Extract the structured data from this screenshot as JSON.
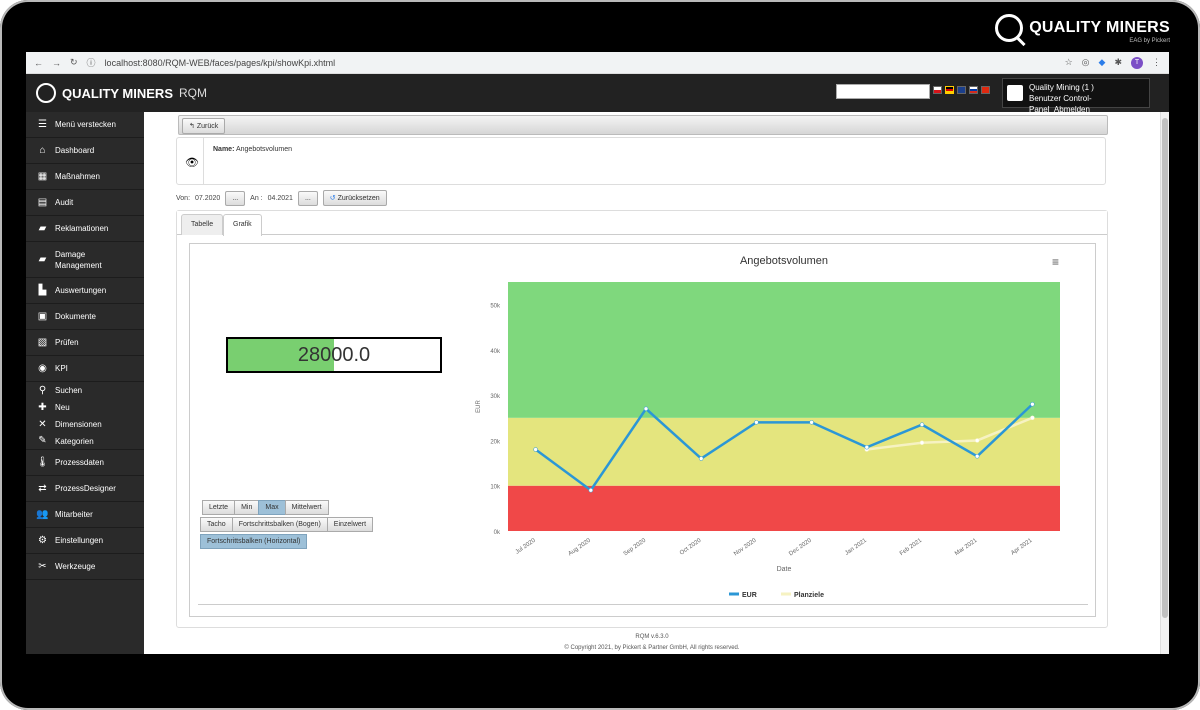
{
  "brand": {
    "name": "QUALITY MINERS",
    "sub": "EAG by Pickert"
  },
  "browser": {
    "url": "localhost:8080/RQM-WEB/faces/pages/kpi/showKpi.xhtml",
    "avatar": "T"
  },
  "app": {
    "title": "QUALITY MINERS",
    "product": "RQM"
  },
  "user": {
    "line1": "Quality Mining (1 )",
    "line2": "Benutzer Control-Panel",
    "logout": "Abmelden"
  },
  "sidebar": {
    "items": [
      {
        "label": "Menü verstecken",
        "icon": "menu-icon"
      },
      {
        "label": "Dashboard",
        "icon": "home-icon"
      },
      {
        "label": "Maßnahmen",
        "icon": "table-icon"
      },
      {
        "label": "Audit",
        "icon": "clipboard-icon"
      },
      {
        "label": "Reklamationen",
        "icon": "document-icon"
      },
      {
        "label": "Damage Management",
        "icon": "damage-icon"
      },
      {
        "label": "Auswertungen",
        "icon": "bar-chart-icon"
      },
      {
        "label": "Dokumente",
        "icon": "file-icon"
      },
      {
        "label": "Prüfen",
        "icon": "check-icon"
      },
      {
        "label": "KPI",
        "icon": "gauge-icon"
      },
      {
        "label": "Suchen",
        "icon": "search-icon"
      },
      {
        "label": "Neu",
        "icon": "plus-icon"
      },
      {
        "label": "Dimensionen",
        "icon": "dimension-icon"
      },
      {
        "label": "Kategorien",
        "icon": "category-icon"
      },
      {
        "label": "Prozessdaten",
        "icon": "thermometer-icon"
      },
      {
        "label": "ProzessDesigner",
        "icon": "shuffle-icon"
      },
      {
        "label": "Mitarbeiter",
        "icon": "users-icon"
      },
      {
        "label": "Einstellungen",
        "icon": "gear-icon"
      },
      {
        "label": "Werkzeuge",
        "icon": "tools-icon"
      }
    ]
  },
  "toolbar": {
    "back": "Zurück"
  },
  "kpi": {
    "name_label": "Name:",
    "name_value": "Angebotsvolumen"
  },
  "dates": {
    "from_label": "Von:",
    "from_value": "07.2020",
    "to_label": "An :",
    "to_value": "04.2021",
    "picker": "...",
    "reset": "Zurücksetzen"
  },
  "tabs": {
    "table": "Tabelle",
    "graphic": "Grafik"
  },
  "gauge": {
    "value": "28000.0",
    "fill_fraction": 0.5
  },
  "buttons": {
    "row1": [
      "Letzte",
      "Min",
      "Max",
      "Mittelwert"
    ],
    "row2": [
      "Tacho",
      "Fortschrittsbalken (Bogen)",
      "Einzelwert"
    ],
    "row3": [
      "Fortschrittsbalken (Horizontal)"
    ],
    "selected": [
      "Max",
      "Fortschrittsbalken (Horizontal)"
    ]
  },
  "chart_data": {
    "type": "line",
    "title": "Angebotsvolumen",
    "xlabel": "Date",
    "ylabel": "EUR",
    "categories": [
      "Jul 2020",
      "Aug 2020",
      "Sep 2020",
      "Oct 2020",
      "Nov 2020",
      "Dec 2020",
      "Jan 2021",
      "Feb 2021",
      "Mar 2021",
      "Apr 2021"
    ],
    "y_ticks": [
      "0k",
      "10k",
      "20k",
      "30k",
      "40k",
      "50k"
    ],
    "ylim": [
      0,
      55000
    ],
    "bands": [
      {
        "from": 0,
        "to": 10000,
        "color": "#f04848"
      },
      {
        "from": 10000,
        "to": 25000,
        "color": "#e4e57e"
      },
      {
        "from": 25000,
        "to": 55000,
        "color": "#7fd87d"
      }
    ],
    "series": [
      {
        "name": "EUR",
        "color": "#2b97d6",
        "values": [
          18000,
          9000,
          27000,
          16000,
          24000,
          24000,
          18500,
          23500,
          16500,
          28000
        ]
      },
      {
        "name": "Planziele",
        "color": "#f6f2c2",
        "values": [
          null,
          null,
          null,
          null,
          null,
          null,
          18000,
          19500,
          20000,
          25000
        ]
      }
    ],
    "legend_position": "bottom"
  },
  "footer": {
    "version": "RQM v.6.3.0",
    "copyright": "© Copyright 2021, by Pickert & Partner GmbH, All rights reserved."
  }
}
